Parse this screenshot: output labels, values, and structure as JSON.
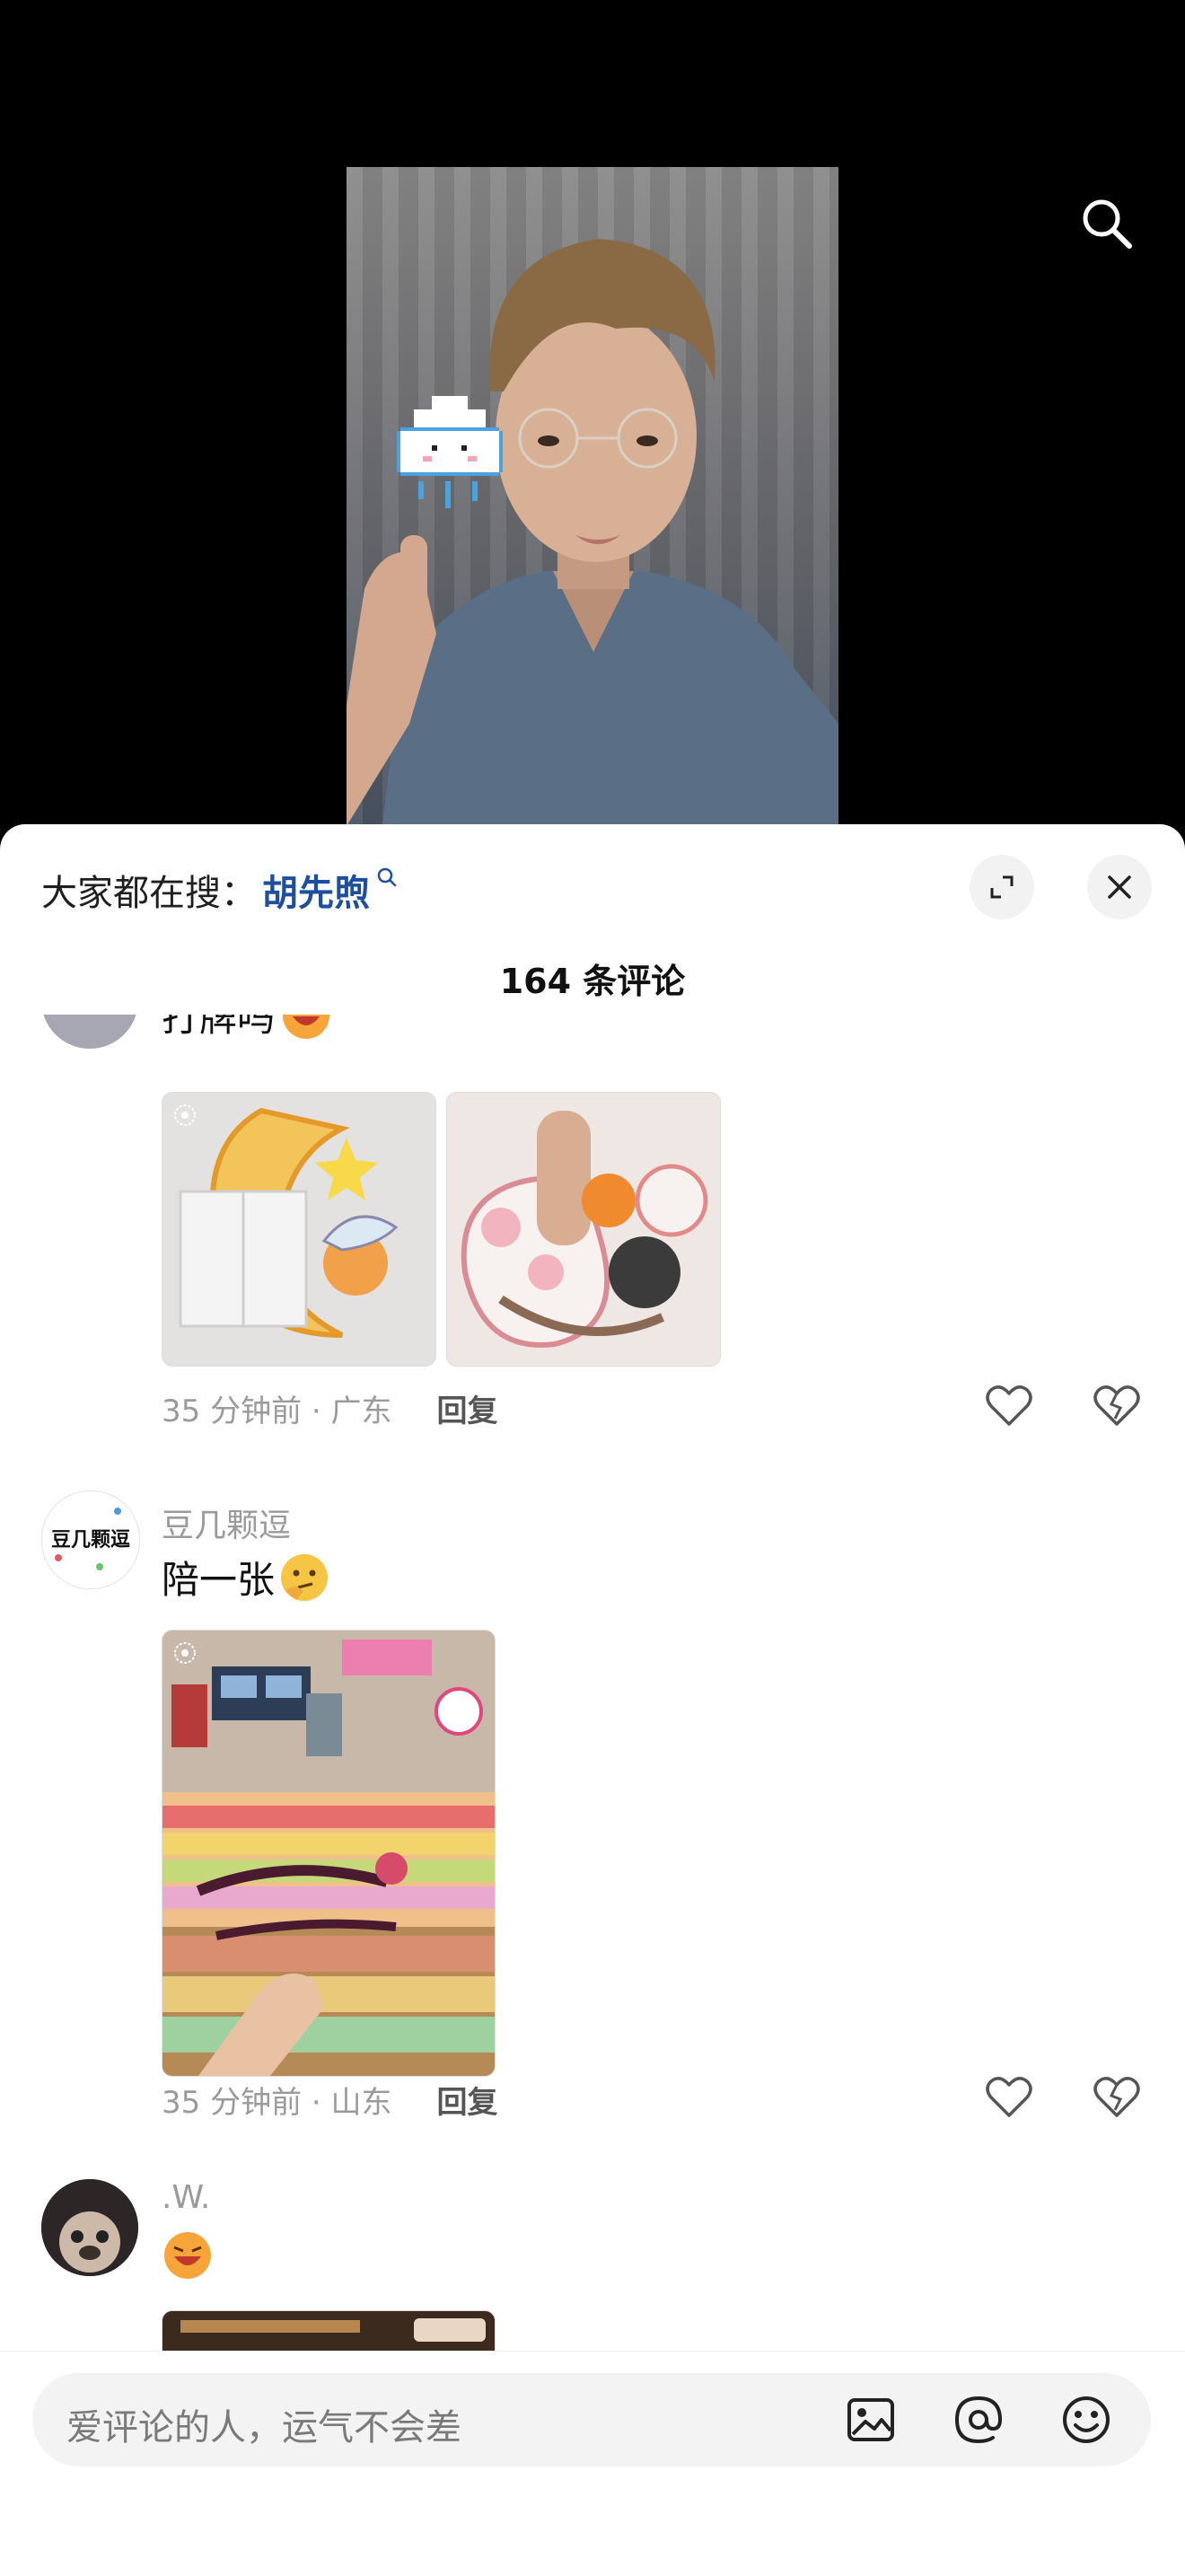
{
  "video": {
    "icons": {
      "search": "search-icon"
    }
  },
  "header": {
    "hot_search_label": "大家都在搜：",
    "hot_search_keyword": "胡先煦",
    "comment_count": "164 条评论"
  },
  "comments": [
    {
      "username": "",
      "text": "打牌吗",
      "time_location": "35 分钟前 · 广东",
      "reply_label": "回复"
    },
    {
      "username": "豆几颗逗",
      "avatar_text": "豆几颗逗",
      "text": "陪一张",
      "time_location": "35 分钟前 · 山东",
      "reply_label": "回复"
    },
    {
      "username": ".W.",
      "text": "",
      "time_location": "",
      "reply_label": ""
    }
  ],
  "bottom": {
    "input_placeholder": "爱评论的人，运气不会差",
    "icons": [
      "image-icon",
      "at-icon",
      "emoji-icon"
    ]
  },
  "colors": {
    "keyword": "#1d4f9e",
    "sheet_bg": "#ffffff",
    "input_bg": "#f3f3f3"
  }
}
